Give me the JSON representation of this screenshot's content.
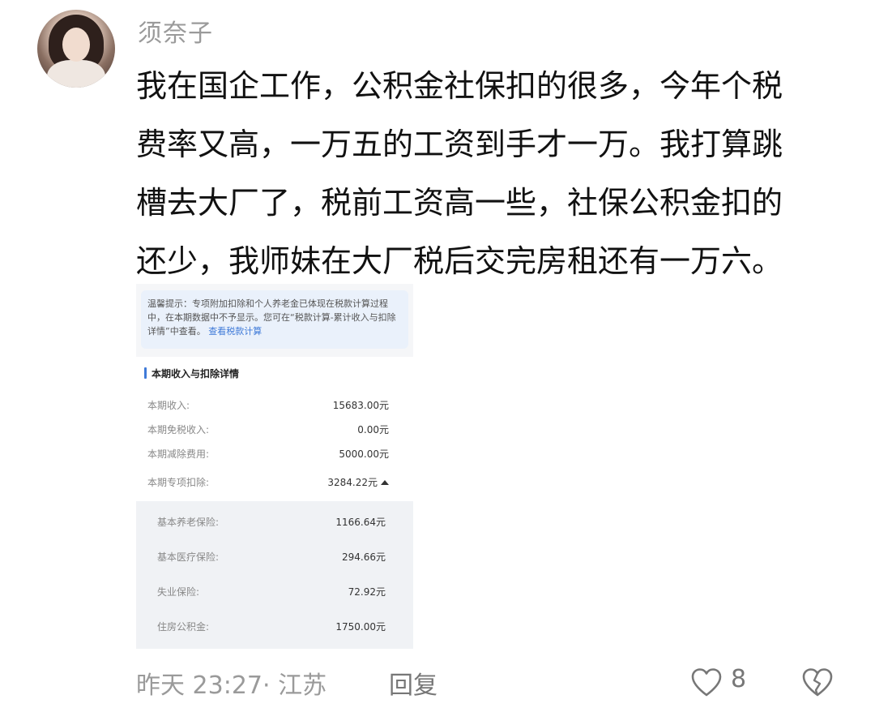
{
  "user": {
    "name": "须奈子"
  },
  "comment": {
    "lines": [
      "我在国企工作，公积金社保扣的很多，今年个税",
      "费率又高，一万五的工资到手才一万。我打算跳",
      "槽去大厂了，税前工资高一些，社保公积金扣的",
      "还少，我师妹在大厂税后交完房租还有一万六。"
    ]
  },
  "screenshot": {
    "tip": {
      "text": "温馨提示：专项附加扣除和个人养老金已体现在税款计算过程中，在本期数据中不予显示。您可在“税款计算-累计收入与扣除详情”中查看。",
      "link": "查看税款计算"
    },
    "section_title": "本期收入与扣除详情",
    "rows": [
      {
        "label": "本期收入:",
        "value": "15683.00元"
      },
      {
        "label": "本期免税收入:",
        "value": "0.00元"
      },
      {
        "label": "本期减除费用:",
        "value": "5000.00元"
      }
    ],
    "special": {
      "label": "本期专项扣除:",
      "value": "3284.22元"
    },
    "sub_rows": [
      {
        "label": "基本养老保险:",
        "value": "1166.64元"
      },
      {
        "label": "基本医疗保险:",
        "value": "294.66元"
      },
      {
        "label": "失业保险:",
        "value": "72.92元"
      },
      {
        "label": "住房公积金:",
        "value": "1750.00元"
      }
    ]
  },
  "footer": {
    "time_location": "昨天 23:27· 江苏",
    "reply": "回复",
    "like_count": "8",
    "like_icon": "heart-outline-icon",
    "dislike_icon": "broken-heart-icon"
  }
}
